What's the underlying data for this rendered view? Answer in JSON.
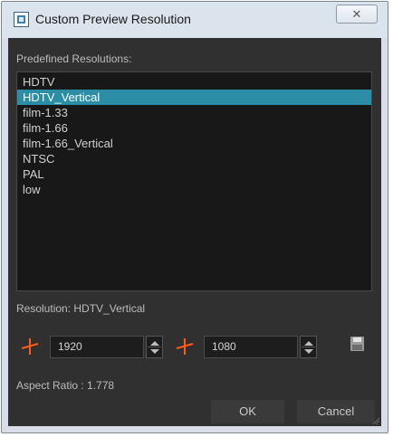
{
  "window": {
    "title": "Custom Preview Resolution",
    "close_label": "✕"
  },
  "predefined": {
    "label": "Predefined Resolutions:",
    "items": [
      "HDTV",
      "HDTV_Vertical",
      "film-1.33",
      "film-1.66",
      "film-1.66_Vertical",
      "NTSC",
      "PAL",
      "low"
    ],
    "selected": "HDTV_Vertical"
  },
  "resolution": {
    "label": "Resolution:",
    "name": "HDTV_Vertical",
    "width": "1920",
    "height": "1080"
  },
  "aspect": {
    "label": "Aspect Ratio :",
    "value": "1.778"
  },
  "buttons": {
    "ok": "OK",
    "cancel": "Cancel"
  },
  "colors": {
    "selection": "#2b8ea6",
    "dimension_icon": "#ff5a1a"
  }
}
